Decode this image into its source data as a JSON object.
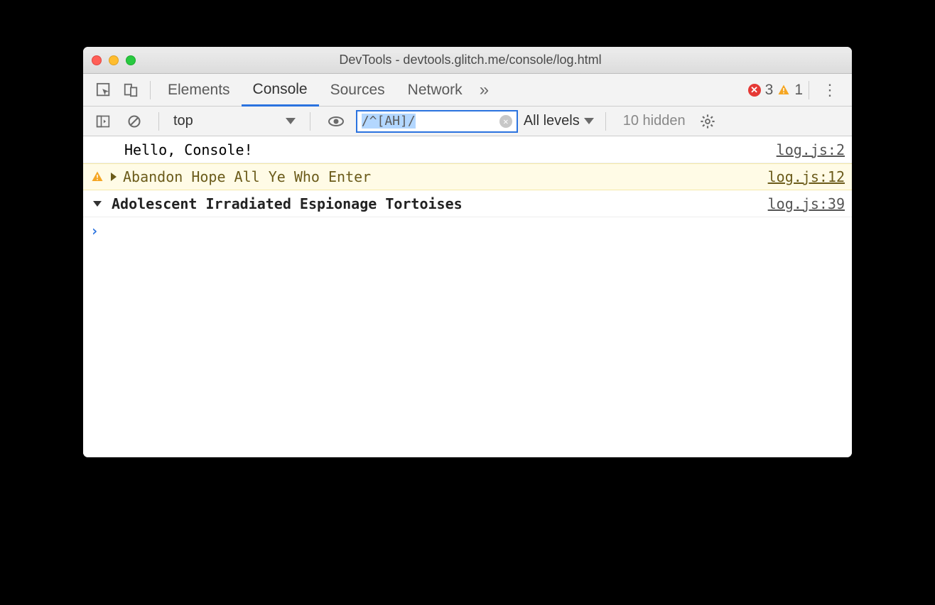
{
  "window": {
    "title": "DevTools - devtools.glitch.me/console/log.html"
  },
  "tabs": {
    "elements": "Elements",
    "console": "Console",
    "sources": "Sources",
    "network": "Network"
  },
  "badges": {
    "errors": "3",
    "warnings": "1"
  },
  "toolbar": {
    "context": "top",
    "filter_value": "/^[AH]/",
    "levels_label": "All levels",
    "hidden_label": "10 hidden"
  },
  "logs": [
    {
      "msg": "Hello, Console!",
      "src": "log.js:2"
    },
    {
      "msg": "Abandon Hope All Ye Who Enter",
      "src": "log.js:12"
    },
    {
      "msg": "Adolescent Irradiated Espionage Tortoises",
      "src": "log.js:39"
    }
  ]
}
